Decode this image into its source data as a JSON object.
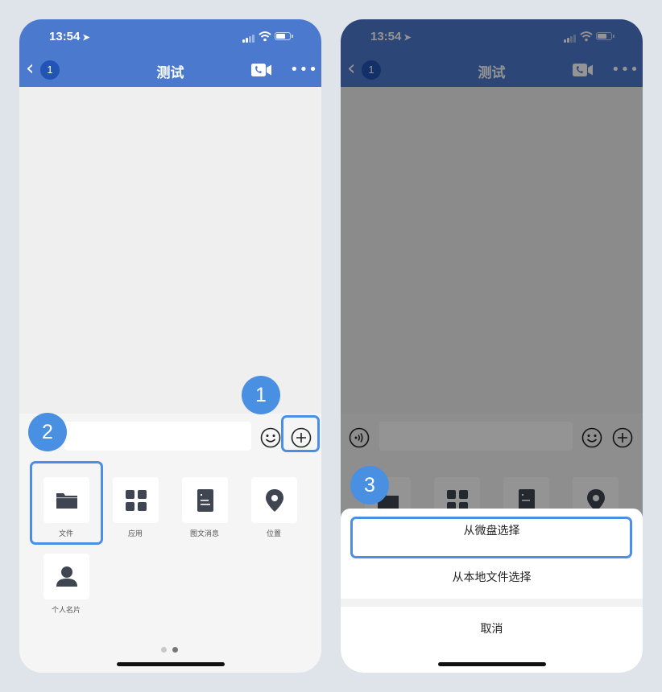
{
  "theme": {
    "header_color": "#4a79cd",
    "accent": "#4a90e2"
  },
  "left_phone": {
    "status": {
      "time": "13:54",
      "location_glyph": "➤"
    },
    "header": {
      "back_glyph": "‹",
      "unread_badge": "1",
      "title": "测试",
      "video_icon": "video-call-icon",
      "more_glyph": "•••"
    },
    "input_bar": {
      "emoji_icon": "smiley-icon",
      "plus_icon": "plus-circle-icon"
    },
    "tools": [
      {
        "label": "文件",
        "icon": "folder-icon"
      },
      {
        "label": "应用",
        "icon": "apps-grid-icon"
      },
      {
        "label": "图文消息",
        "icon": "document-icon"
      },
      {
        "label": "位置",
        "icon": "location-pin-icon"
      },
      {
        "label": "个人名片",
        "icon": "person-icon"
      }
    ],
    "page_indicator": {
      "count": 2,
      "active_index": 1
    },
    "step_badges": [
      "1",
      "2"
    ]
  },
  "right_phone": {
    "status": {
      "time": "13:54",
      "location_glyph": "➤"
    },
    "header": {
      "back_glyph": "‹",
      "unread_badge": "1",
      "title": "测试"
    },
    "action_sheet": {
      "options": [
        "从微盘选择",
        "从本地文件选择"
      ],
      "cancel": "取消"
    },
    "step_badge": "3"
  }
}
